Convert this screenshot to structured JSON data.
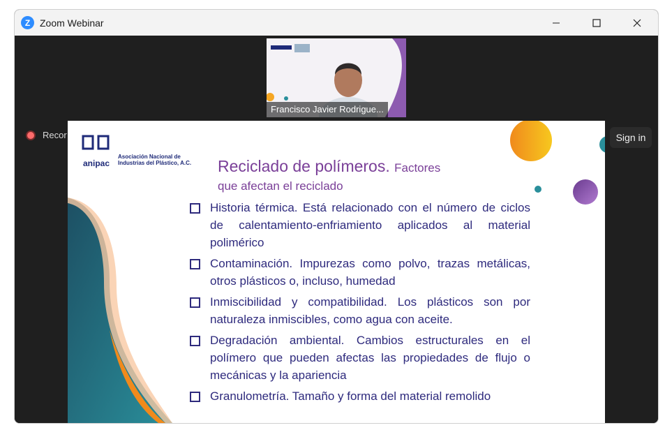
{
  "window": {
    "title": "Zoom Webinar",
    "app_icon_letter": "Z"
  },
  "video_thumb": {
    "participant_name": "Francisco Javier Rodrigue..."
  },
  "recording": {
    "label": "Recor"
  },
  "signin": {
    "label": "Sign in"
  },
  "slide": {
    "logo_name": "anipac",
    "logo_caption_line1": "Asociación Nacional de",
    "logo_caption_line2": "Industrias del Plástico, A.C.",
    "title_main": "Reciclado de polímeros.",
    "title_sub": "Factores",
    "title_line2": "que afectan el reciclado",
    "bullets": [
      "Historia térmica. Está relacionado con el número de ciclos de calentamiento-enfriamiento aplicados al material polimérico",
      "Contaminación. Impurezas como polvo, trazas metálicas, otros plásticos o, incluso, humedad",
      "Inmiscibilidad y compatibilidad. Los plásticos son por naturaleza inmiscibles, como agua con aceite.",
      "Degradación ambiental. Cambios estructurales en el polímero que pueden afectas las propiedades de flujo o mecánicas y la apariencia",
      "Granulometría. Tamaño y forma del material remolido"
    ]
  },
  "colors": {
    "accent_purple": "#7a3f98",
    "bullet_blue": "#2e2a7d",
    "orange": "#f5a623",
    "teal": "#2a8f9b"
  }
}
